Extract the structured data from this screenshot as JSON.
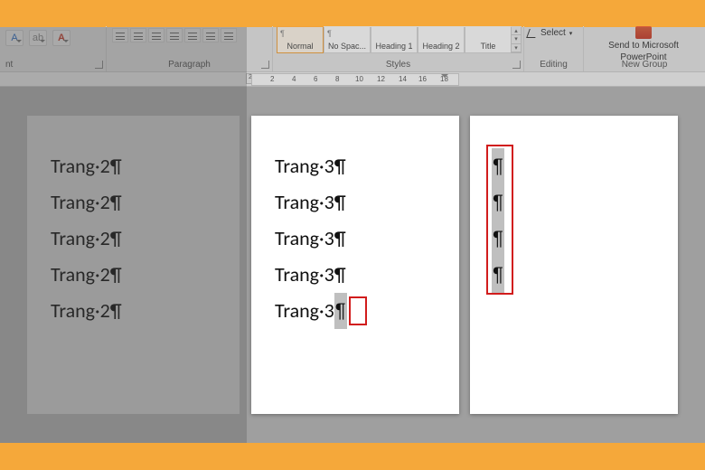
{
  "ribbon": {
    "font_group_label": "nt",
    "paragraph_group_label": "Paragraph",
    "styles_group_label": "Styles",
    "editing_group_label": "Editing",
    "newgroup_label": "New Group",
    "styles": [
      {
        "label": "Normal",
        "selected": true
      },
      {
        "label": "No Spac...",
        "selected": false
      },
      {
        "label": "Heading 1",
        "selected": false
      },
      {
        "label": "Heading 2",
        "selected": false
      },
      {
        "label": "Title",
        "selected": false
      }
    ],
    "editing_select": "Select",
    "send_to": "Send to Microsoft\nPowerPoint"
  },
  "ruler": {
    "ticks": [
      "2",
      "4",
      "6",
      "8",
      "10",
      "12",
      "14",
      "16",
      "18"
    ],
    "left_num": "2",
    "left_outside": "2"
  },
  "pages": {
    "left": {
      "lines": [
        "Trang·2¶",
        "Trang·2¶",
        "Trang·2¶",
        "Trang·2¶",
        "Trang·2¶"
      ]
    },
    "mid": {
      "lines": [
        "Trang·3¶",
        "Trang·3¶",
        "Trang·3¶",
        "Trang·3¶",
        "Trang·3"
      ],
      "last_selected_mark": "¶"
    },
    "right": {
      "selected_marks": [
        "¶",
        "¶",
        "¶",
        "¶"
      ]
    }
  },
  "icons": {
    "text_effects": "A",
    "highlight": "ab",
    "font_color": "A"
  }
}
